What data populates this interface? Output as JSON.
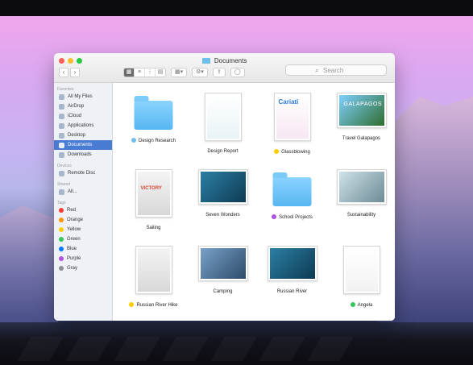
{
  "window": {
    "title": "Documents",
    "search_placeholder": "Search"
  },
  "sidebar": {
    "sections": {
      "favorites": "Favorites",
      "devices": "Devices",
      "shared": "Shared",
      "tags": "Tags"
    },
    "favorites": [
      {
        "label": "All My Files",
        "icon": "all-files-icon"
      },
      {
        "label": "AirDrop",
        "icon": "airdrop-icon"
      },
      {
        "label": "iCloud",
        "icon": "cloud-icon"
      },
      {
        "label": "Applications",
        "icon": "applications-icon"
      },
      {
        "label": "Desktop",
        "icon": "desktop-icon"
      },
      {
        "label": "Documents",
        "icon": "documents-icon",
        "active": true
      },
      {
        "label": "Downloads",
        "icon": "downloads-icon"
      }
    ],
    "devices": [
      {
        "label": "Remote Disc",
        "icon": "disc-icon"
      }
    ],
    "shared": [
      {
        "label": "All...",
        "icon": "network-icon"
      }
    ],
    "tags": [
      {
        "label": "Red",
        "color": "#ff3b30"
      },
      {
        "label": "Orange",
        "color": "#ff9500"
      },
      {
        "label": "Yellow",
        "color": "#ffcc00"
      },
      {
        "label": "Green",
        "color": "#34c759"
      },
      {
        "label": "Blue",
        "color": "#007aff"
      },
      {
        "label": "Purple",
        "color": "#af52de"
      },
      {
        "label": "Gray",
        "color": "#8e8e93"
      }
    ]
  },
  "files": [
    {
      "label": "Design Research",
      "tag_color": "#6fbfeb",
      "kind": "folder"
    },
    {
      "label": "Design Report",
      "tag_color": "",
      "kind": "doc"
    },
    {
      "label": "Glassblowing",
      "tag_color": "#ffcc00",
      "kind": "doc"
    },
    {
      "label": "Travel Galapagos",
      "tag_color": "",
      "kind": "pic"
    },
    {
      "label": "Sailing",
      "tag_color": "",
      "kind": "doc"
    },
    {
      "label": "Seven Wonders",
      "tag_color": "",
      "kind": "pic"
    },
    {
      "label": "School Projects",
      "tag_color": "#af52de",
      "kind": "folder"
    },
    {
      "label": "Sustainability",
      "tag_color": "",
      "kind": "pic"
    },
    {
      "label": "Russian River Hike",
      "tag_color": "#ffcc00",
      "kind": "doc"
    },
    {
      "label": "Camping",
      "tag_color": "",
      "kind": "pic"
    },
    {
      "label": "Russian River",
      "tag_color": "",
      "kind": "pic"
    },
    {
      "label": "Angela",
      "tag_color": "#34c759",
      "kind": "doc"
    }
  ],
  "thumb_text": {
    "glassblowing_title": "Cariati",
    "galapagos_title": "GALAPAGOS",
    "sailing_title": "VICTORY"
  }
}
